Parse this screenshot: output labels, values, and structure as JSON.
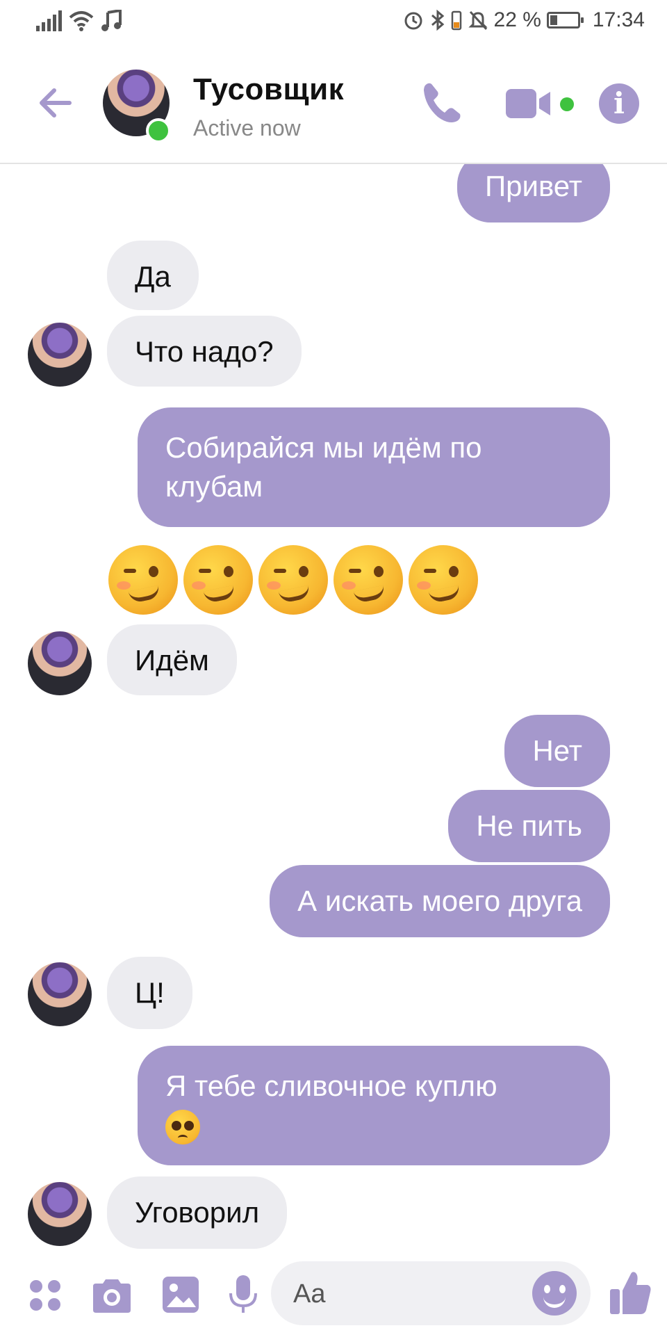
{
  "status_bar": {
    "battery_percent": "22 %",
    "time": "17:34",
    "icons": [
      "signal-icon",
      "wifi-icon",
      "music-icon",
      "alarm-icon",
      "bluetooth-icon",
      "mute-icon",
      "battery-icon"
    ]
  },
  "header": {
    "contact_name": "Тусовщик",
    "contact_status": "Active now",
    "icons": [
      "back-arrow-icon",
      "phone-icon",
      "video-camera-icon",
      "info-icon"
    ]
  },
  "messages": [
    {
      "from": "me",
      "text": "Привет"
    },
    {
      "from": "them",
      "text": "Да"
    },
    {
      "from": "them",
      "text": "Что надо?"
    },
    {
      "from": "me",
      "text": "Собирайся мы идём по клубам"
    },
    {
      "from": "them",
      "text": "🥴🥴🥴🥴🥴",
      "emoji_name": "woozy-face"
    },
    {
      "from": "them",
      "text": "Идём"
    },
    {
      "from": "me",
      "text": "Нет"
    },
    {
      "from": "me",
      "text": "Не пить"
    },
    {
      "from": "me",
      "text": "А искать моего друга"
    },
    {
      "from": "them",
      "text": "Ц!"
    },
    {
      "from": "me",
      "text": "Я тебе сливочное куплю",
      "emoji_name": "pleading-face"
    },
    {
      "from": "them",
      "text": "Уговорил"
    }
  ],
  "composer": {
    "placeholder": "Aa",
    "icons": [
      "apps-grid-icon",
      "camera-icon",
      "gallery-icon",
      "microphone-icon",
      "emoji-icon",
      "thumbs-up-icon"
    ]
  },
  "colors": {
    "accent": "#a598cc",
    "incoming_bubble": "#ececf0",
    "online": "#3fc23f"
  }
}
